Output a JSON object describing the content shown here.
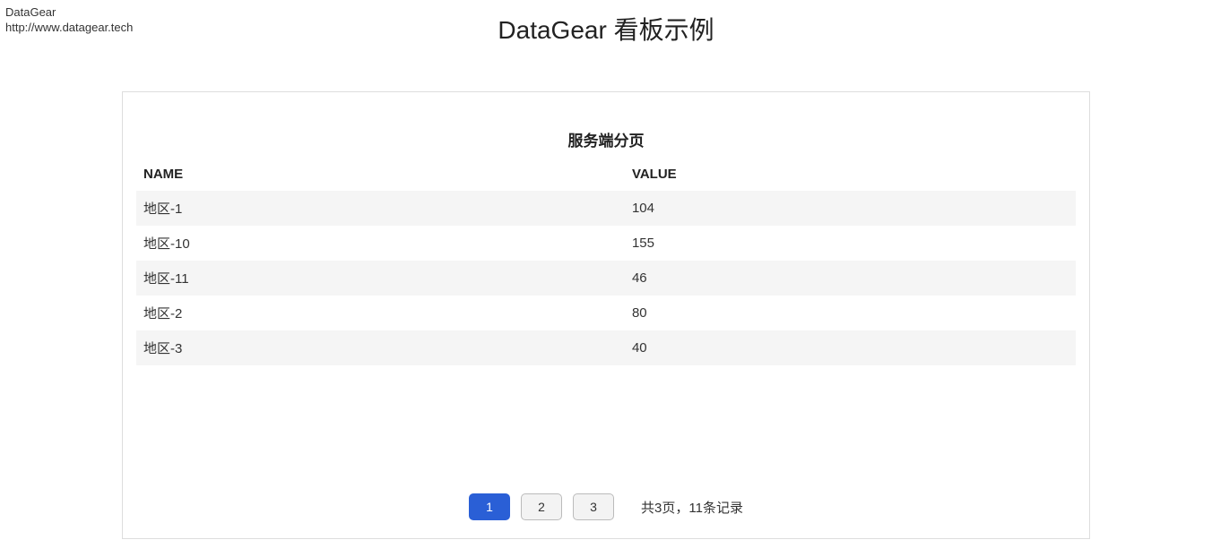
{
  "brand": {
    "name": "DataGear",
    "url": "http://www.datagear.tech"
  },
  "page": {
    "title": "DataGear 看板示例"
  },
  "table": {
    "title": "服务端分页",
    "columns": {
      "name": "NAME",
      "value": "VALUE"
    },
    "rows": [
      {
        "name": "地区-1",
        "value": "104"
      },
      {
        "name": "地区-10",
        "value": "155"
      },
      {
        "name": "地区-11",
        "value": "46"
      },
      {
        "name": "地区-2",
        "value": "80"
      },
      {
        "name": "地区-3",
        "value": "40"
      }
    ]
  },
  "pagination": {
    "pages": [
      "1",
      "2",
      "3"
    ],
    "current": 1,
    "summary": "共3页，11条记录"
  }
}
